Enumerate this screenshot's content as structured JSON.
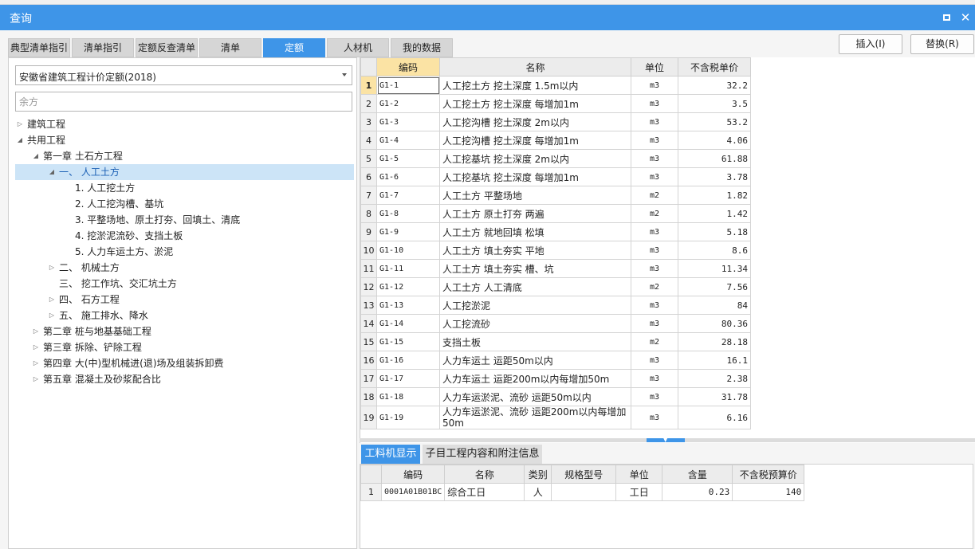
{
  "window": {
    "title": "查询"
  },
  "tabs": [
    {
      "label": "典型清单指引"
    },
    {
      "label": "清单指引"
    },
    {
      "label": "定额反查清单"
    },
    {
      "label": "清单"
    },
    {
      "label": "定额",
      "active": true
    },
    {
      "label": "人材机"
    },
    {
      "label": "我的数据"
    }
  ],
  "buttons": {
    "insert": "插入(I)",
    "replace": "替换(R)"
  },
  "left": {
    "select_value": "安徽省建筑工程计价定额(2018)",
    "search_placeholder": "余方",
    "tree": [
      {
        "label": "建筑工程",
        "level": 0,
        "caret": "collapsed"
      },
      {
        "label": "共用工程",
        "level": 0,
        "caret": "expanded"
      },
      {
        "label": "第一章 土石方工程",
        "level": 1,
        "caret": "expanded"
      },
      {
        "label": "一、 人工土方",
        "level": 2,
        "caret": "expanded",
        "selected": true
      },
      {
        "label": "1. 人工挖土方",
        "level": 3,
        "caret": "none"
      },
      {
        "label": "2. 人工挖沟槽、基坑",
        "level": 3,
        "caret": "none"
      },
      {
        "label": "3. 平整场地、原土打夯、回填土、清底",
        "level": 3,
        "caret": "none"
      },
      {
        "label": "4. 挖淤泥流砂、支挡土板",
        "level": 3,
        "caret": "none"
      },
      {
        "label": "5. 人力车运土方、淤泥",
        "level": 3,
        "caret": "none"
      },
      {
        "label": "二、 机械土方",
        "level": 2,
        "caret": "collapsed"
      },
      {
        "label": "三、 挖工作坑、交汇坑土方",
        "level": 2,
        "caret": "none"
      },
      {
        "label": "四、 石方工程",
        "level": 2,
        "caret": "collapsed"
      },
      {
        "label": "五、 施工排水、降水",
        "level": 2,
        "caret": "collapsed"
      },
      {
        "label": "第二章 桩与地基基础工程",
        "level": 1,
        "caret": "collapsed"
      },
      {
        "label": "第三章 拆除、铲除工程",
        "level": 1,
        "caret": "collapsed"
      },
      {
        "label": "第四章 大(中)型机械进(退)场及组装拆卸费",
        "level": 1,
        "caret": "collapsed"
      },
      {
        "label": "第五章 混凝土及砂浆配合比",
        "level": 1,
        "caret": "collapsed"
      }
    ]
  },
  "quota_table": {
    "headers": [
      "编码",
      "名称",
      "单位",
      "不含税单价"
    ],
    "rows": [
      {
        "no": "1",
        "code": "G1-1",
        "name": "人工挖土方 挖土深度 1.5m以内",
        "unit": "m3",
        "price": "32.2"
      },
      {
        "no": "2",
        "code": "G1-2",
        "name": "人工挖土方 挖土深度 每增加1m",
        "unit": "m3",
        "price": "3.5"
      },
      {
        "no": "3",
        "code": "G1-3",
        "name": "人工挖沟槽 挖土深度 2m以内",
        "unit": "m3",
        "price": "53.2"
      },
      {
        "no": "4",
        "code": "G1-4",
        "name": "人工挖沟槽 挖土深度 每增加1m",
        "unit": "m3",
        "price": "4.06"
      },
      {
        "no": "5",
        "code": "G1-5",
        "name": "人工挖基坑 挖土深度 2m以内",
        "unit": "m3",
        "price": "61.88"
      },
      {
        "no": "6",
        "code": "G1-6",
        "name": "人工挖基坑 挖土深度 每增加1m",
        "unit": "m3",
        "price": "3.78"
      },
      {
        "no": "7",
        "code": "G1-7",
        "name": "人工土方 平整场地",
        "unit": "m2",
        "price": "1.82"
      },
      {
        "no": "8",
        "code": "G1-8",
        "name": "人工土方 原土打夯 两遍",
        "unit": "m2",
        "price": "1.42"
      },
      {
        "no": "9",
        "code": "G1-9",
        "name": "人工土方 就地回填 松填",
        "unit": "m3",
        "price": "5.18"
      },
      {
        "no": "10",
        "code": "G1-10",
        "name": "人工土方 填土夯实 平地",
        "unit": "m3",
        "price": "8.6"
      },
      {
        "no": "11",
        "code": "G1-11",
        "name": "人工土方 填土夯实 槽、坑",
        "unit": "m3",
        "price": "11.34"
      },
      {
        "no": "12",
        "code": "G1-12",
        "name": "人工土方 人工清底",
        "unit": "m2",
        "price": "7.56"
      },
      {
        "no": "13",
        "code": "G1-13",
        "name": "人工挖淤泥",
        "unit": "m3",
        "price": "84"
      },
      {
        "no": "14",
        "code": "G1-14",
        "name": "人工挖流砂",
        "unit": "m3",
        "price": "80.36"
      },
      {
        "no": "15",
        "code": "G1-15",
        "name": "支挡土板",
        "unit": "m2",
        "price": "28.18"
      },
      {
        "no": "16",
        "code": "G1-16",
        "name": "人力车运土 运距50m以内",
        "unit": "m3",
        "price": "16.1"
      },
      {
        "no": "17",
        "code": "G1-17",
        "name": "人力车运土 运距200m以内每增加50m",
        "unit": "m3",
        "price": "2.38"
      },
      {
        "no": "18",
        "code": "G1-18",
        "name": "人力车运淤泥、流砂 运距50m以内",
        "unit": "m3",
        "price": "31.78"
      },
      {
        "no": "19",
        "code": "G1-19",
        "name": "人力车运淤泥、流砂 运距200m以内每增加50m",
        "unit": "m3",
        "price": "6.16"
      }
    ]
  },
  "bottom_tabs": [
    {
      "label": "工料机显示",
      "active": true
    },
    {
      "label": "子目工程内容和附注信息"
    }
  ],
  "material_table": {
    "headers": [
      "编码",
      "名称",
      "类别",
      "规格型号",
      "单位",
      "含量",
      "不含税预算价"
    ],
    "rows": [
      {
        "no": "1",
        "code": "0001A01B01BC",
        "name": "综合工日",
        "type": "人",
        "spec": "",
        "unit": "工日",
        "qty": "0.23",
        "price": "140"
      }
    ]
  },
  "colors": {
    "accent": "#3e95e8",
    "header_highlight": "#fbe3a4",
    "selection": "#cce4f7"
  }
}
